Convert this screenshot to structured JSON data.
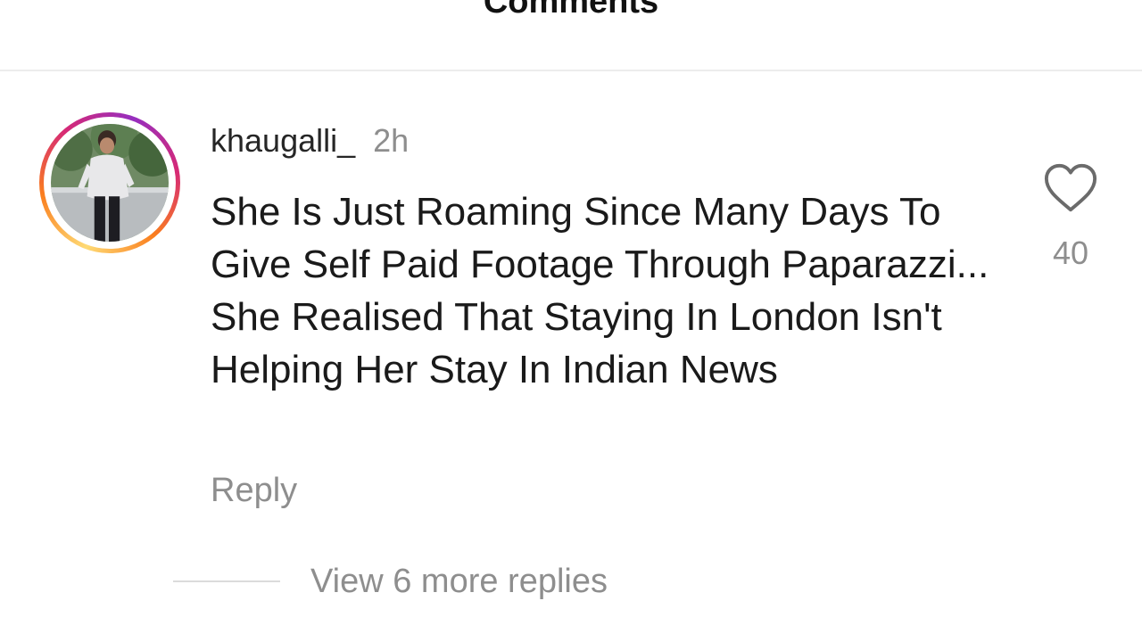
{
  "header": {
    "title": "Comments"
  },
  "comment": {
    "username": "khaugalli_",
    "timestamp": "2h",
    "text": "She Is Just Roaming Since Many Days To Give Self Paid Footage Through Paparazzi... She Realised That Staying In London Isn't Helping Her Stay In Indian News",
    "reply_label": "Reply",
    "like_count": "40",
    "like_icon": "heart-outline-icon",
    "view_replies_label": "View 6 more replies"
  },
  "colors": {
    "text_primary": "#262626",
    "text_secondary": "#8e8e8e",
    "story_ring_start": "#feda75",
    "story_ring_end": "#d62976",
    "divider": "#ececec"
  }
}
